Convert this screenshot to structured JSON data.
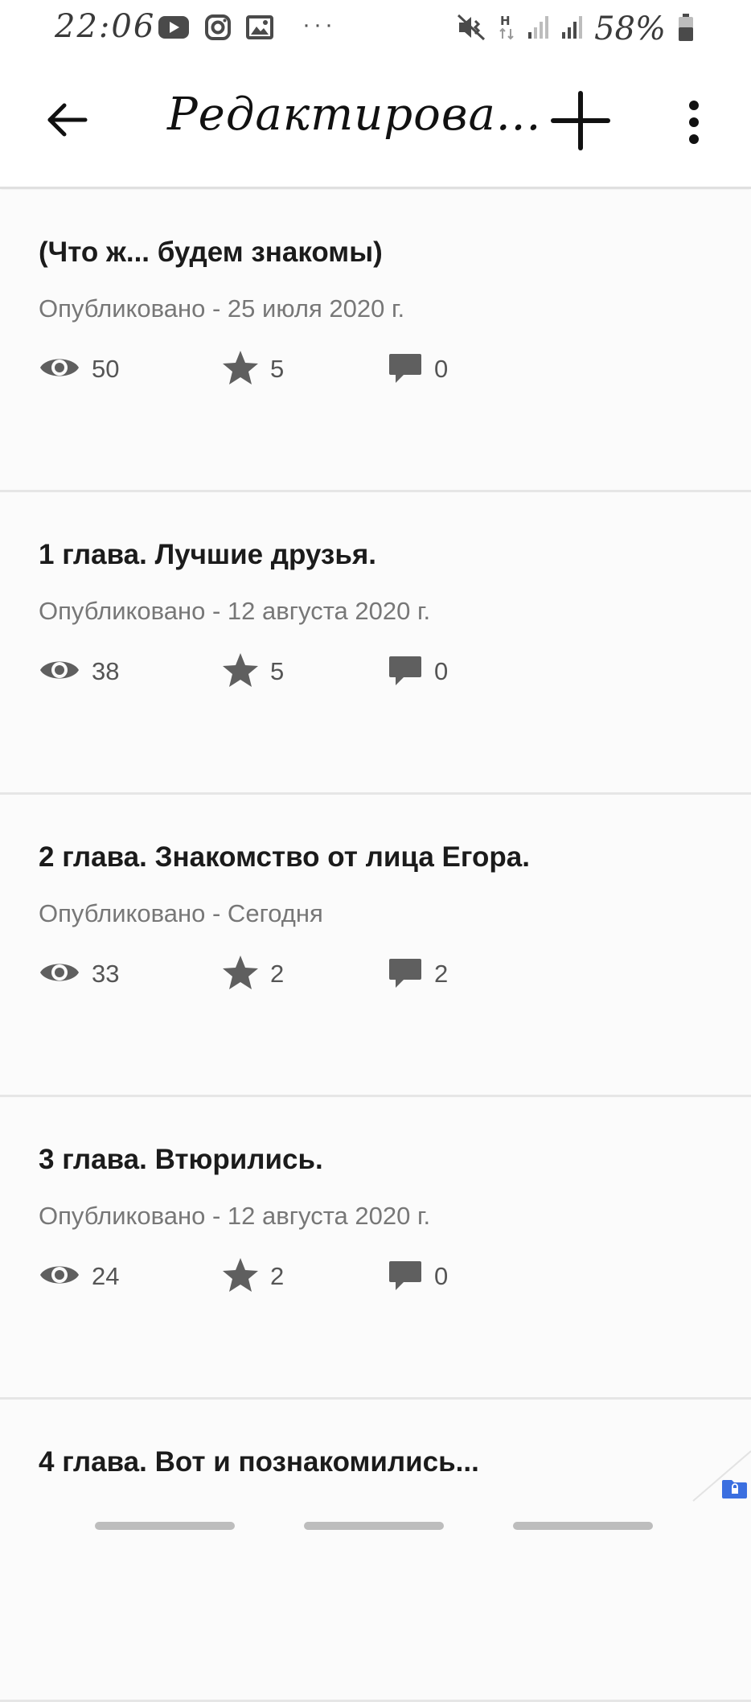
{
  "status_bar": {
    "time": "22:06",
    "icons_left": [
      "youtube-icon",
      "instagram-icon",
      "gallery-icon"
    ],
    "more_dots": "···",
    "icons_right": [
      "mute-vibrate-icon",
      "h-data-icon",
      "signal-icon",
      "signal-icon",
      "battery-icon"
    ],
    "battery": "58%"
  },
  "app_bar": {
    "title": "Редактирова..."
  },
  "chapters": [
    {
      "title": "(Что ж... будем знакомы)",
      "date": "Опубликовано - 25 июля 2020 г.",
      "views": "50",
      "stars": "5",
      "comments": "0"
    },
    {
      "title": "1 глава. Лучшие друзья.",
      "date": "Опубликовано - 12 августа 2020 г.",
      "views": "38",
      "stars": "5",
      "comments": "0"
    },
    {
      "title": "2 глава. Знакомство от лица Егора.",
      "date": "Опубликовано - Сегодня",
      "views": "33",
      "stars": "2",
      "comments": "2"
    },
    {
      "title": "3 глава. Втюрились.",
      "date": "Опубликовано - 12 августа 2020 г.",
      "views": "24",
      "stars": "2",
      "comments": "0"
    },
    {
      "title": "4 глава. Вот и познакомились..."
    }
  ],
  "colors": {
    "title_text": "#1b1b1b",
    "secondary_text": "#777777",
    "icon_gray": "#5f5f5f",
    "card_bg": "#fbfbfb",
    "divider": "#e6e6e6",
    "badge_blue": "#3b6fe0"
  }
}
